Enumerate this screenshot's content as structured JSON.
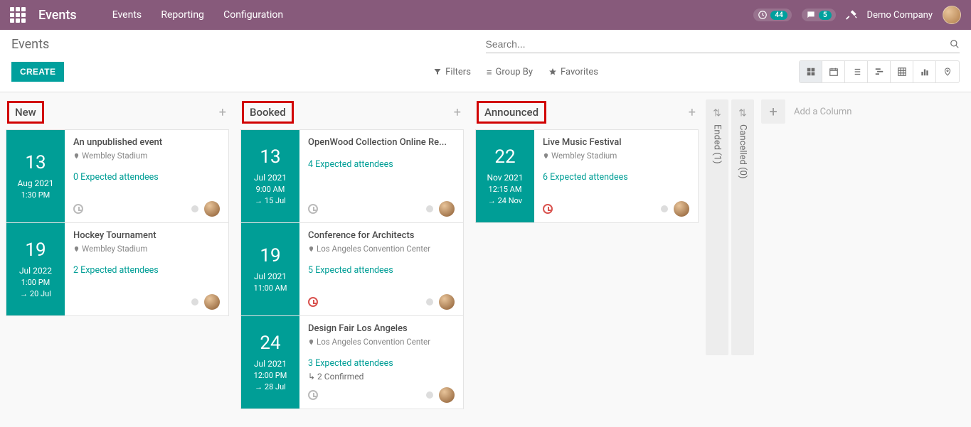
{
  "nav": {
    "brand": "Events",
    "menu": [
      "Events",
      "Reporting",
      "Configuration"
    ],
    "badges": {
      "activities": "44",
      "messages": "5"
    },
    "company": "Demo Company"
  },
  "controls": {
    "breadcrumb": "Events",
    "search_placeholder": "Search...",
    "create": "CREATE",
    "filters": "Filters",
    "groupby": "Group By",
    "favorites": "Favorites"
  },
  "columns": [
    {
      "title": "New",
      "boxed": true,
      "cards": [
        {
          "day": "13",
          "mon": "Aug 2021",
          "time": "1:30 PM",
          "until": "",
          "title": "An unpublished event",
          "loc": "Wembley Stadium",
          "att": "0 Expected attendees",
          "conf": "",
          "clock": "grey"
        },
        {
          "day": "19",
          "mon": "Jul 2022",
          "time": "1:00 PM",
          "until": "→ 20 Jul",
          "title": "Hockey Tournament",
          "loc": "Wembley Stadium",
          "att": "2 Expected attendees",
          "conf": "",
          "clock": ""
        }
      ]
    },
    {
      "title": "Booked",
      "boxed": true,
      "cards": [
        {
          "day": "13",
          "mon": "Jul 2021",
          "time": "9:00 AM",
          "until": "→ 15 Jul",
          "title": "OpenWood Collection Online Re...",
          "loc": "",
          "att": "4 Expected attendees",
          "conf": "",
          "clock": "grey"
        },
        {
          "day": "19",
          "mon": "Jul 2021",
          "time": "11:00 AM",
          "until": "",
          "title": "Conference for Architects",
          "loc": "Los Angeles Convention Center",
          "att": "5 Expected attendees",
          "conf": "",
          "clock": "red"
        },
        {
          "day": "24",
          "mon": "Jul 2021",
          "time": "12:00 PM",
          "until": "→ 28 Jul",
          "title": "Design Fair Los Angeles",
          "loc": "Los Angeles Convention Center",
          "att": "3 Expected attendees",
          "conf": "↳ 2 Confirmed",
          "clock": "grey"
        }
      ]
    },
    {
      "title": "Announced",
      "boxed": true,
      "cards": [
        {
          "day": "22",
          "mon": "Nov 2021",
          "time": "12:15 AM",
          "until": "→ 24 Nov",
          "title": "Live Music Festival",
          "loc": "Wembley Stadium",
          "att": "6 Expected attendees",
          "conf": "",
          "clock": "red"
        }
      ]
    }
  ],
  "folded": [
    {
      "label": "Ended (1)"
    },
    {
      "label": "Cancelled (0)"
    }
  ],
  "addcol": "Add a Column"
}
